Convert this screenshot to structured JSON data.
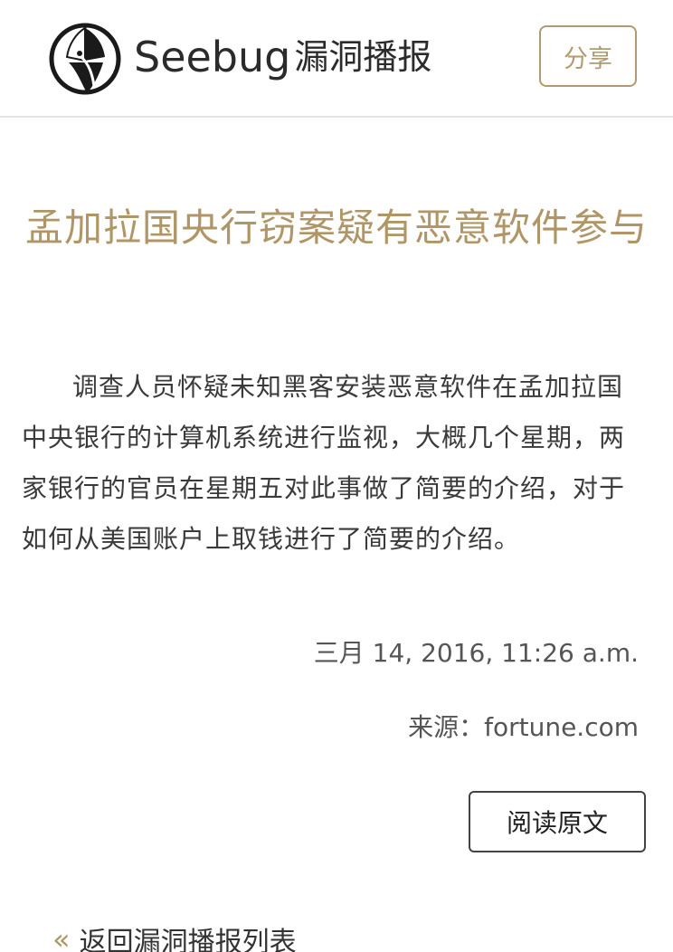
{
  "header": {
    "logo_word": "Seebug",
    "logo_sub": "漏洞播报",
    "share_label": "分享"
  },
  "article": {
    "title": "孟加拉国央行窃案疑有恶意软件参与",
    "body": "调查人员怀疑未知黑客安装恶意软件在孟加拉国中央银行的计算机系统进行监视，大概几个星期，两家银行的官员在星期五对此事做了简要的介绍，对于如何从美国账户上取钱进行了简要的介绍。",
    "date": "三月 14, 2016, 11:26 a.m.",
    "source": "来源：fortune.com",
    "read_original_label": "阅读原文"
  },
  "footer": {
    "back_chevron": "«",
    "back_label": "返回漏洞播报列表"
  },
  "colors": {
    "accent": "#b09567",
    "divider": "#e3e3e3"
  },
  "icons": {
    "logo": "seebug-logo-icon",
    "back": "double-chevron-left-icon"
  }
}
